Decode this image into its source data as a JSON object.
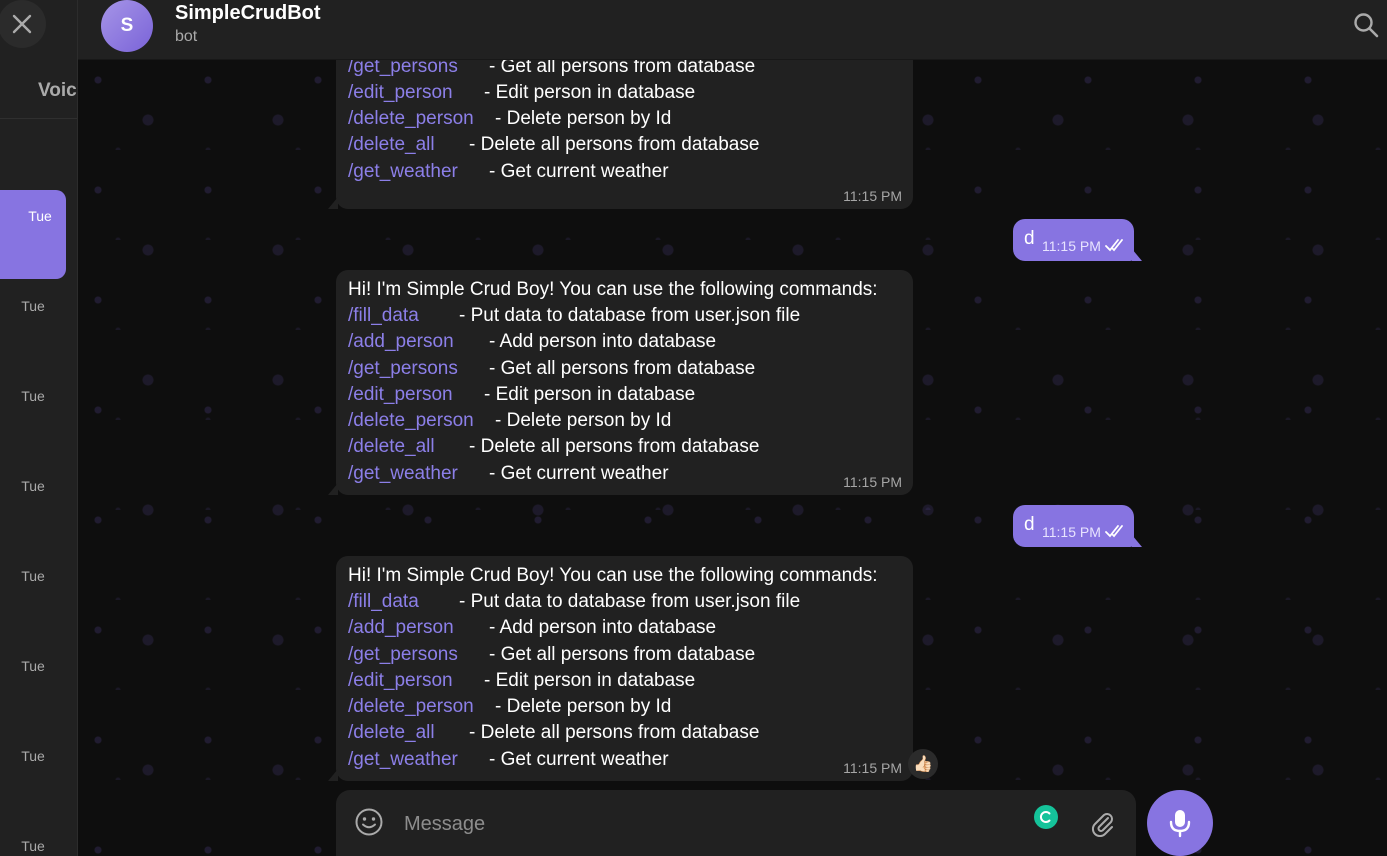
{
  "sidebar": {
    "voice_label": "Voic",
    "days": [
      "Tue",
      "Tue",
      "Tue",
      "Tue",
      "Tue",
      "Tue",
      "Tue",
      "Tue"
    ]
  },
  "header": {
    "avatar_letter": "S",
    "title": "SimpleCrudBot",
    "subtitle": "bot"
  },
  "messages": {
    "greeting": "Hi! I'm Simple Crud Boy! You can use the following commands:",
    "commands": [
      {
        "cmd": "/fill_data",
        "desc": "- Put data to database from user.json file"
      },
      {
        "cmd": "/add_person",
        "desc": "- Add person into database"
      },
      {
        "cmd": "/get_persons",
        "desc": "- Get all persons from database"
      },
      {
        "cmd": "/edit_person",
        "desc": "- Edit person in database"
      },
      {
        "cmd": "/delete_person",
        "desc": "- Delete person by Id"
      },
      {
        "cmd": "/delete_all",
        "desc": "- Delete all persons from database"
      },
      {
        "cmd": "/get_weather",
        "desc": "- Get current weather"
      }
    ],
    "time": "11:15 PM",
    "outgoing_text": "d",
    "outgoing_time": "11:15 PM",
    "reaction": "👍🏻"
  },
  "composer": {
    "placeholder": "Message"
  },
  "colors": {
    "accent": "#8774e1",
    "bubble_in": "#212121",
    "command_link": "#8c7fe8"
  }
}
